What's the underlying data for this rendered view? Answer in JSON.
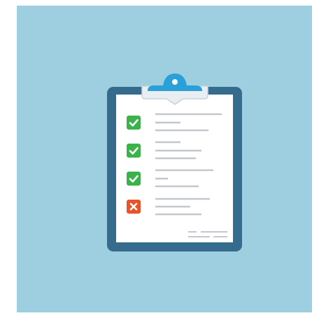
{
  "colors": {
    "page_bg": "#ffffff",
    "panel_bg": "#9dcfe0",
    "board": "#356b8c",
    "paper": "#ffffff",
    "clip": "#2a9fd8",
    "clip_band": "#e9eef2",
    "clip_outline": "#c9d3da",
    "check": "#3cb24a",
    "cross": "#e8532a",
    "line": "#c4c8cc"
  },
  "icons": {
    "clipboard": "clipboard-icon",
    "clip": "clip-icon",
    "check": "checkmark-icon",
    "cross": "cross-icon"
  },
  "checklist": {
    "items": [
      {
        "status": "checked"
      },
      {
        "status": "checked"
      },
      {
        "status": "checked"
      },
      {
        "status": "failed"
      }
    ]
  }
}
